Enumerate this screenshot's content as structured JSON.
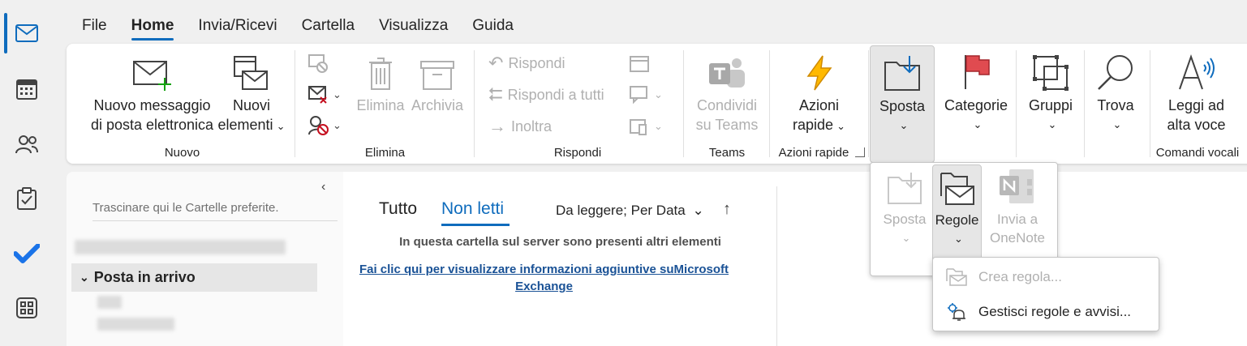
{
  "rail": {
    "items": [
      "mail-icon",
      "calendar-icon",
      "people-icon",
      "tasks-icon",
      "todo-icon",
      "apps-icon"
    ],
    "accent": "#0f6cbd"
  },
  "menu": {
    "tabs": [
      "File",
      "Home",
      "Invia/Ricevi",
      "Cartella",
      "Visualizza",
      "Guida"
    ],
    "active": "Home"
  },
  "ribbon": {
    "new_group": {
      "label": "Nuovo",
      "new_mail_line1": "Nuovo messaggio",
      "new_mail_line2": "di posta elettronica",
      "new_items_line1": "Nuovi",
      "new_items_line2": "elementi"
    },
    "delete_group": {
      "label": "Elimina",
      "delete": "Elimina",
      "archive": "Archivia"
    },
    "respond_group": {
      "label": "Rispondi",
      "reply": "Rispondi",
      "reply_all": "Rispondi a tutti",
      "forward": "Inoltra"
    },
    "teams_group": {
      "label": "Teams",
      "share_line1": "Condividi",
      "share_line2": "su Teams"
    },
    "quick_group": {
      "label": "Azioni rapide",
      "btn_line1": "Azioni",
      "btn_line2": "rapide"
    },
    "move": "Sposta",
    "categories": "Categorie",
    "groups": "Gruppi",
    "find": "Trova",
    "voice_group": {
      "label": "Comandi vocali",
      "btn_line1": "Leggi ad",
      "btn_line2": "alta voce"
    }
  },
  "folder_pane": {
    "favorites_hint": "Trascinare qui le Cartelle preferite.",
    "inbox": "Posta in arrivo"
  },
  "message_list": {
    "tab_all": "Tutto",
    "tab_unread": "Non letti",
    "sort": "Da leggere; Per Data",
    "server_notice": "In questa cartella sul server sono presenti altri elementi",
    "link_line1": "Fai clic qui per visualizzare informazioni aggiuntive suMicrosoft",
    "link_line2": "Exchange"
  },
  "move_popup": {
    "move": "Sposta",
    "rules": "Regole",
    "onenote_line1": "Invia a",
    "onenote_line2": "OneNote"
  },
  "rules_popup": {
    "create_rule": "Crea regola...",
    "manage_rules": "Gestisci regole e avvisi..."
  }
}
